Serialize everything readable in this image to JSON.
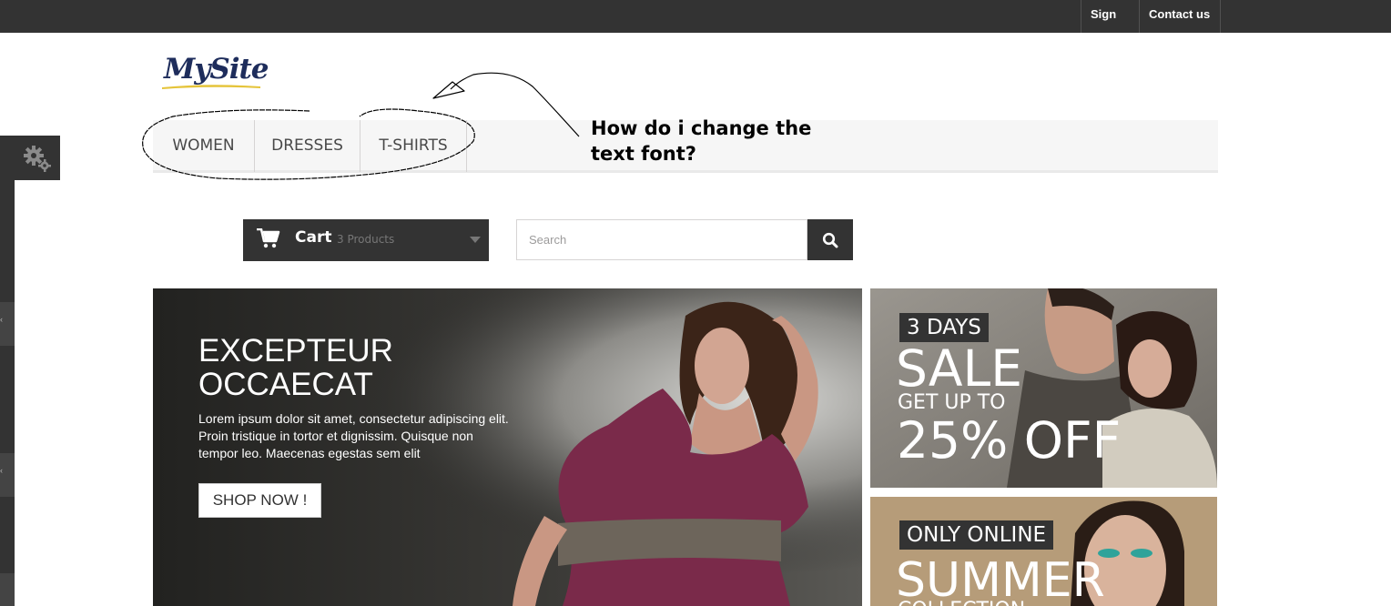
{
  "topbar": {
    "signin": "Sign in",
    "contact": "Contact us"
  },
  "logo": {
    "text": "MySite"
  },
  "menu": {
    "items": [
      {
        "label": "WOMEN"
      },
      {
        "label": "DRESSES"
      },
      {
        "label": "T-SHIRTS"
      }
    ]
  },
  "annotation": {
    "line1": "How do i change the",
    "line2": "text font?"
  },
  "cart": {
    "label": "Cart",
    "count": "3 Products"
  },
  "search": {
    "placeholder": "Search"
  },
  "slider": {
    "title_line1": "EXCEPTEUR",
    "title_line2": "OCCAECAT",
    "text": "Lorem ipsum dolor sit amet, consectetur adipiscing elit. Proin tristique in tortor et dignissim. Quisque non tempor leo. Maecenas egestas sem elit",
    "button": "SHOP NOW !"
  },
  "banners": [
    {
      "tag": "3 DAYS",
      "big": "SALE",
      "sub": "GET UP TO",
      "big2": "25% OFF"
    },
    {
      "tag": "ONLY ONLINE",
      "big": "SUMMER",
      "sub": "COLLECTION"
    }
  ],
  "colors": {
    "dark": "#333333",
    "menu_bg": "#f6f6f6",
    "logo": "#1e2d5c"
  }
}
